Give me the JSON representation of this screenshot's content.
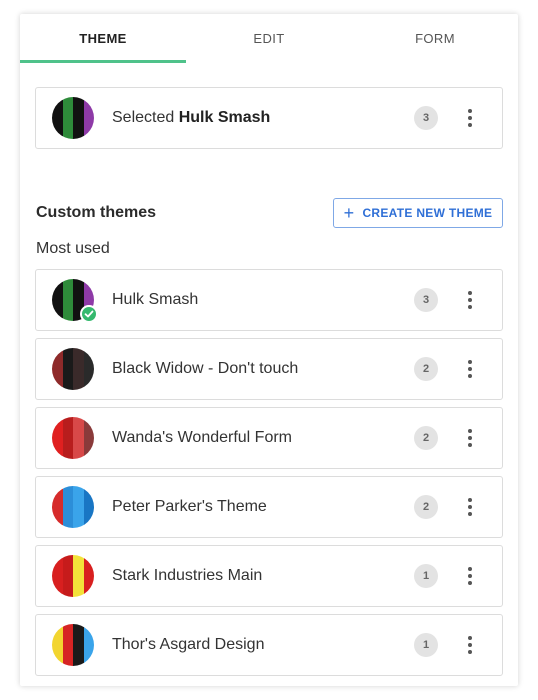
{
  "tabs": [
    {
      "label": "THEME",
      "active": true
    },
    {
      "label": "EDIT",
      "active": false
    },
    {
      "label": "FORM",
      "active": false
    }
  ],
  "selected": {
    "prefix": "Selected",
    "name": "Hulk Smash",
    "count": "3",
    "colors": [
      "#111111",
      "#2e8b3a",
      "#111111",
      "#8e3aa7"
    ]
  },
  "custom": {
    "title": "Custom themes",
    "create_label": "CREATE NEW THEME",
    "most_used_label": "Most used"
  },
  "themes": [
    {
      "name": "Hulk Smash",
      "count": "3",
      "selected": true,
      "colors": [
        "#111111",
        "#2e8b3a",
        "#111111",
        "#8e3aa7"
      ]
    },
    {
      "name": "Black Widow - Don't touch",
      "count": "2",
      "selected": false,
      "colors": [
        "#8e2a2a",
        "#1a1a1a",
        "#3a2a2a",
        "#2a2a2a"
      ]
    },
    {
      "name": "Wanda's Wonderful Form",
      "count": "2",
      "selected": false,
      "colors": [
        "#e02020",
        "#b81d1d",
        "#d84848",
        "#8a3a3a"
      ]
    },
    {
      "name": "Peter Parker's Theme",
      "count": "2",
      "selected": false,
      "colors": [
        "#d62b2b",
        "#2c8ed8",
        "#3aa4ea",
        "#1976c4"
      ]
    },
    {
      "name": "Stark Industries Main",
      "count": "1",
      "selected": false,
      "colors": [
        "#d81f1f",
        "#c61b1b",
        "#f3e23a",
        "#d81f1f"
      ]
    },
    {
      "name": "Thor's Asgard Design",
      "count": "1",
      "selected": false,
      "colors": [
        "#f2d530",
        "#d62424",
        "#1a1a1a",
        "#3aa4ea"
      ]
    }
  ],
  "colors": {
    "accent": "#4fc28a",
    "link": "#2f6fd6",
    "check": "#35b96e"
  }
}
